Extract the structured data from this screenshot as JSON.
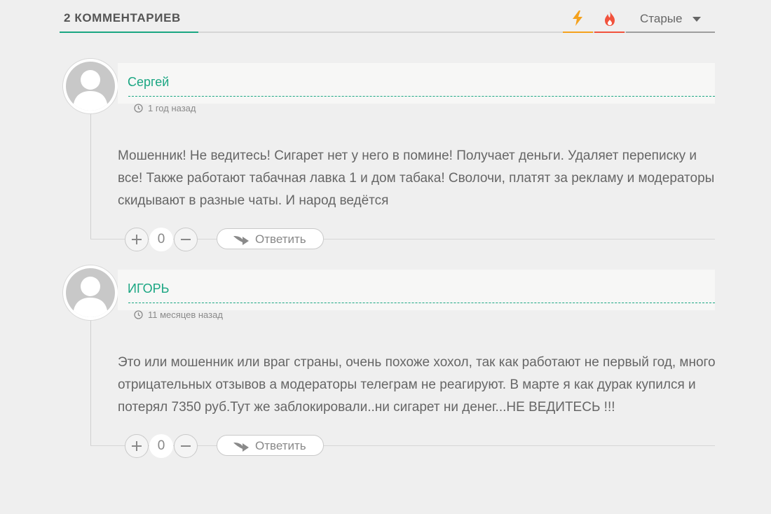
{
  "header": {
    "title": "2 КОММЕНТАРИЕВ",
    "sort": {
      "newest_icon": "bolt-icon",
      "hottest_icon": "flame-icon",
      "oldest_label": "Старые",
      "colors": {
        "newest": "#f4a11d",
        "hottest": "#f1523c",
        "accent": "#1aa682"
      }
    }
  },
  "comments": [
    {
      "author": "Сергей",
      "time": "1 год назад",
      "text": "Мошенник! Не ведитесь! Сигарет нет у него в помине! Получает деньги. Удаляет переписку и все! Также работают табачная лавка 1 и дом табака! Сволочи, платят за рекламу и модераторы скидывают в разные чаты. И народ ведётся",
      "votes": "0",
      "reply_label": "Ответить"
    },
    {
      "author": "ИГОРЬ",
      "time": "11 месяцев назад",
      "text": "Это или мошенник или враг страны, очень похоже хохол, так как работают не первый год, много отрицательных отзывов а модераторы телеграм не реагируют. В марте я как дурак купился и потерял 7350 руб.Тут же заблокировали..ни сигарет ни денег...НЕ ВЕДИТЕСЬ !!!",
      "votes": "0",
      "reply_label": "Ответить"
    }
  ]
}
